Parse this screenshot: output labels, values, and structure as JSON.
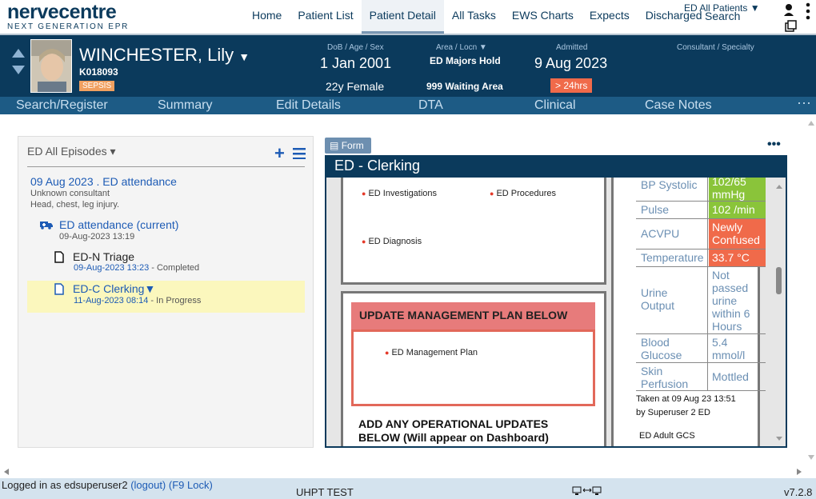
{
  "brand": {
    "name": "nervecentre",
    "tagline": "NEXT GENERATION EPR"
  },
  "nav": {
    "items": [
      "Home",
      "Patient List",
      "Patient Detail",
      "All Tasks",
      "EWS Charts",
      "Expects",
      "Discharged"
    ],
    "active": "Patient Detail",
    "all_patients": "ED All Patients ▼",
    "search": "Search"
  },
  "patient": {
    "name": "WINCHESTER, Lily",
    "name_caret": "▼",
    "mrn": "K018093",
    "badge": "SEPSIS",
    "dob_label": "DoB / Age / Sex",
    "dob": "1 Jan 2001",
    "age_sex": "22y Female",
    "area_label": "Area / Locn  ▼",
    "area": "ED Majors Hold",
    "location": "999 Waiting Area",
    "admitted_label": "Admitted",
    "admitted": "9 Aug 2023",
    "stay": "> 24hrs",
    "consultant_label": "Consultant / Specialty"
  },
  "subnav": [
    "Search/Register",
    "Summary",
    "Edit Details",
    "DTA",
    "Clinical",
    "Case Notes"
  ],
  "subnav_more": "···",
  "episodes": {
    "title": "ED All Episodes ▾",
    "episode_title": "09 Aug 2023 . ED attendance",
    "consultant": "Unknown consultant",
    "complaint": "Head, chest, leg injury.",
    "attendance": {
      "label": "ED attendance (current)",
      "time": "09-Aug-2023 13:19"
    },
    "triage": {
      "label": "ED-N Triage",
      "time": "09-Aug-2023 13:23",
      "status": " - Completed"
    },
    "clerking": {
      "label": "ED-C Clerking▼",
      "time": "11-Aug-2023 08:14",
      "status": " - In Progress"
    }
  },
  "form": {
    "button": "Form",
    "title": "ED - Clerking",
    "items": [
      "ED Investigations",
      "ED Procedures",
      "ED Diagnosis"
    ],
    "plan_header": "UPDATE MANAGEMENT PLAN BELOW",
    "plan_item": "ED Management Plan",
    "operational_1": "ADD ANY OPERATIONAL UPDATES",
    "operational_2": "BELOW (Will appear on Dashboard)"
  },
  "vitals": {
    "rows": [
      {
        "label": "BP Systolic",
        "value": "102/65 mmHg",
        "status": "green"
      },
      {
        "label": "Pulse",
        "value": "102 /min",
        "status": "green"
      },
      {
        "label": "ACVPU",
        "value": "Newly Confused",
        "status": "red"
      },
      {
        "label": "Temperature",
        "value": "33.7 °C",
        "status": "red"
      },
      {
        "label": "Urine Output",
        "value": "Not passed urine within 6 Hours",
        "status": "plain"
      },
      {
        "label": "Blood Glucose",
        "value": "5.4 mmol/l",
        "status": "plain"
      },
      {
        "label": "Skin Perfusion",
        "value": "Mottled",
        "status": "plain"
      }
    ],
    "taken_at": "Taken at 09 Aug 23 13:51",
    "taken_by": "by Superuser 2 ED",
    "gcs": "ED Adult GCS",
    "colors": {
      "green": "#8ac43a",
      "red": "#f06a4a"
    }
  },
  "status": {
    "logged_in": "Logged in as edsuperuser2",
    "logout": "(logout)",
    "lock": "(F9 Lock)",
    "env": "UHPT TEST",
    "version": "v7.2.8"
  },
  "colors": {
    "primary": "#0b3a5c",
    "subnav": "#1d5b85",
    "link": "#1d5bb5"
  }
}
